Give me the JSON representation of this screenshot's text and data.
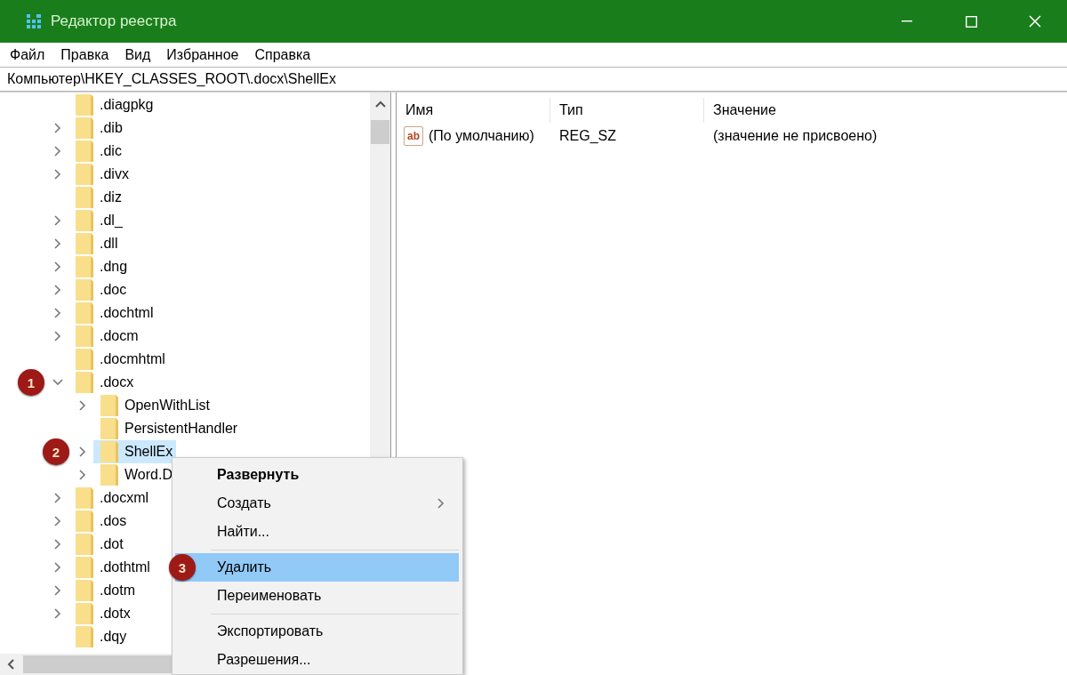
{
  "window": {
    "title": "Редактор реестра"
  },
  "menu_bar": [
    "Файл",
    "Правка",
    "Вид",
    "Избранное",
    "Справка"
  ],
  "address": "Компьютер\\HKEY_CLASSES_ROOT\\.docx\\ShellEx",
  "tree": [
    {
      "label": ".diagpkg",
      "selected": false
    },
    {
      "label": ".dib",
      "expanded": false,
      "selected": false
    },
    {
      "label": ".dic",
      "expanded": false,
      "selected": false
    },
    {
      "label": ".divx",
      "expanded": false,
      "selected": false
    },
    {
      "label": ".diz",
      "selected": false
    },
    {
      "label": ".dl_",
      "expanded": false,
      "selected": false
    },
    {
      "label": ".dll",
      "expanded": false,
      "selected": false
    },
    {
      "label": ".dng",
      "expanded": false,
      "selected": false
    },
    {
      "label": ".doc",
      "expanded": false,
      "selected": false
    },
    {
      "label": ".dochtml",
      "expanded": false,
      "selected": false
    },
    {
      "label": ".docm",
      "expanded": false,
      "selected": false
    },
    {
      "label": ".docmhtml",
      "selected": false
    },
    {
      "label": ".docx",
      "expanded": true,
      "selected": false,
      "badge": "1",
      "children": [
        {
          "label": "OpenWithList",
          "expanded": false,
          "selected": false
        },
        {
          "label": "PersistentHandler",
          "selected": false
        },
        {
          "label": "ShellEx",
          "expanded": false,
          "selected": true,
          "badge": "2"
        },
        {
          "label": "Word.D",
          "expanded": false,
          "selected": false
        }
      ]
    },
    {
      "label": ".docxml",
      "expanded": false,
      "selected": false
    },
    {
      "label": ".dos",
      "expanded": false,
      "selected": false
    },
    {
      "label": ".dot",
      "expanded": false,
      "selected": false
    },
    {
      "label": ".dothtml",
      "expanded": false,
      "selected": false
    },
    {
      "label": ".dotm",
      "expanded": false,
      "selected": false
    },
    {
      "label": ".dotx",
      "expanded": false,
      "selected": false
    },
    {
      "label": ".dqy",
      "selected": false
    }
  ],
  "values_table": {
    "columns": [
      "Имя",
      "Тип",
      "Значение"
    ],
    "rows": [
      {
        "icon_text": "ab",
        "name": "(По умолчанию)",
        "type": "REG_SZ",
        "data": "(значение не присвоено)"
      }
    ]
  },
  "context_menu": {
    "items": [
      {
        "kind": "item",
        "label": "Развернуть",
        "default": true,
        "submenu": false,
        "selected": false
      },
      {
        "kind": "item",
        "label": "Создать",
        "default": false,
        "submenu": true,
        "selected": false
      },
      {
        "kind": "item",
        "label": "Найти...",
        "default": false,
        "submenu": false,
        "selected": false
      },
      {
        "kind": "separator"
      },
      {
        "kind": "item",
        "label": "Удалить",
        "default": false,
        "submenu": false,
        "selected": true,
        "badge": "3"
      },
      {
        "kind": "item",
        "label": "Переименовать",
        "default": false,
        "submenu": false,
        "selected": false
      },
      {
        "kind": "separator"
      },
      {
        "kind": "item",
        "label": "Экспортировать",
        "default": false,
        "submenu": false,
        "selected": false
      },
      {
        "kind": "item",
        "label": "Разрешения...",
        "default": false,
        "submenu": false,
        "selected": false
      }
    ]
  }
}
